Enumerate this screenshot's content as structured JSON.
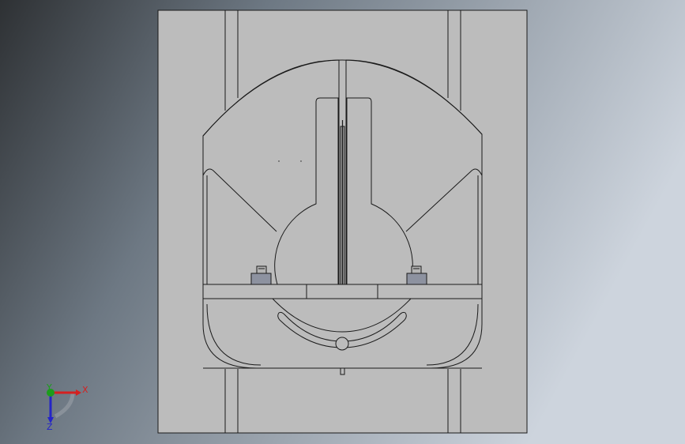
{
  "viewport": {
    "background_colors": {
      "left": "#2e3134",
      "mid": "#6d7883",
      "right": "#cdd4dd"
    },
    "model": {
      "fill_color": "#bcbcbc",
      "line_color": "#1a1a1a",
      "bolt_color": "#8d92a0"
    }
  },
  "triad": {
    "x_label": "X",
    "y_label": "Y",
    "z_label": "Z",
    "colors": {
      "x": "#d42020",
      "y": "#1c9d1c",
      "z": "#2424c8"
    }
  }
}
